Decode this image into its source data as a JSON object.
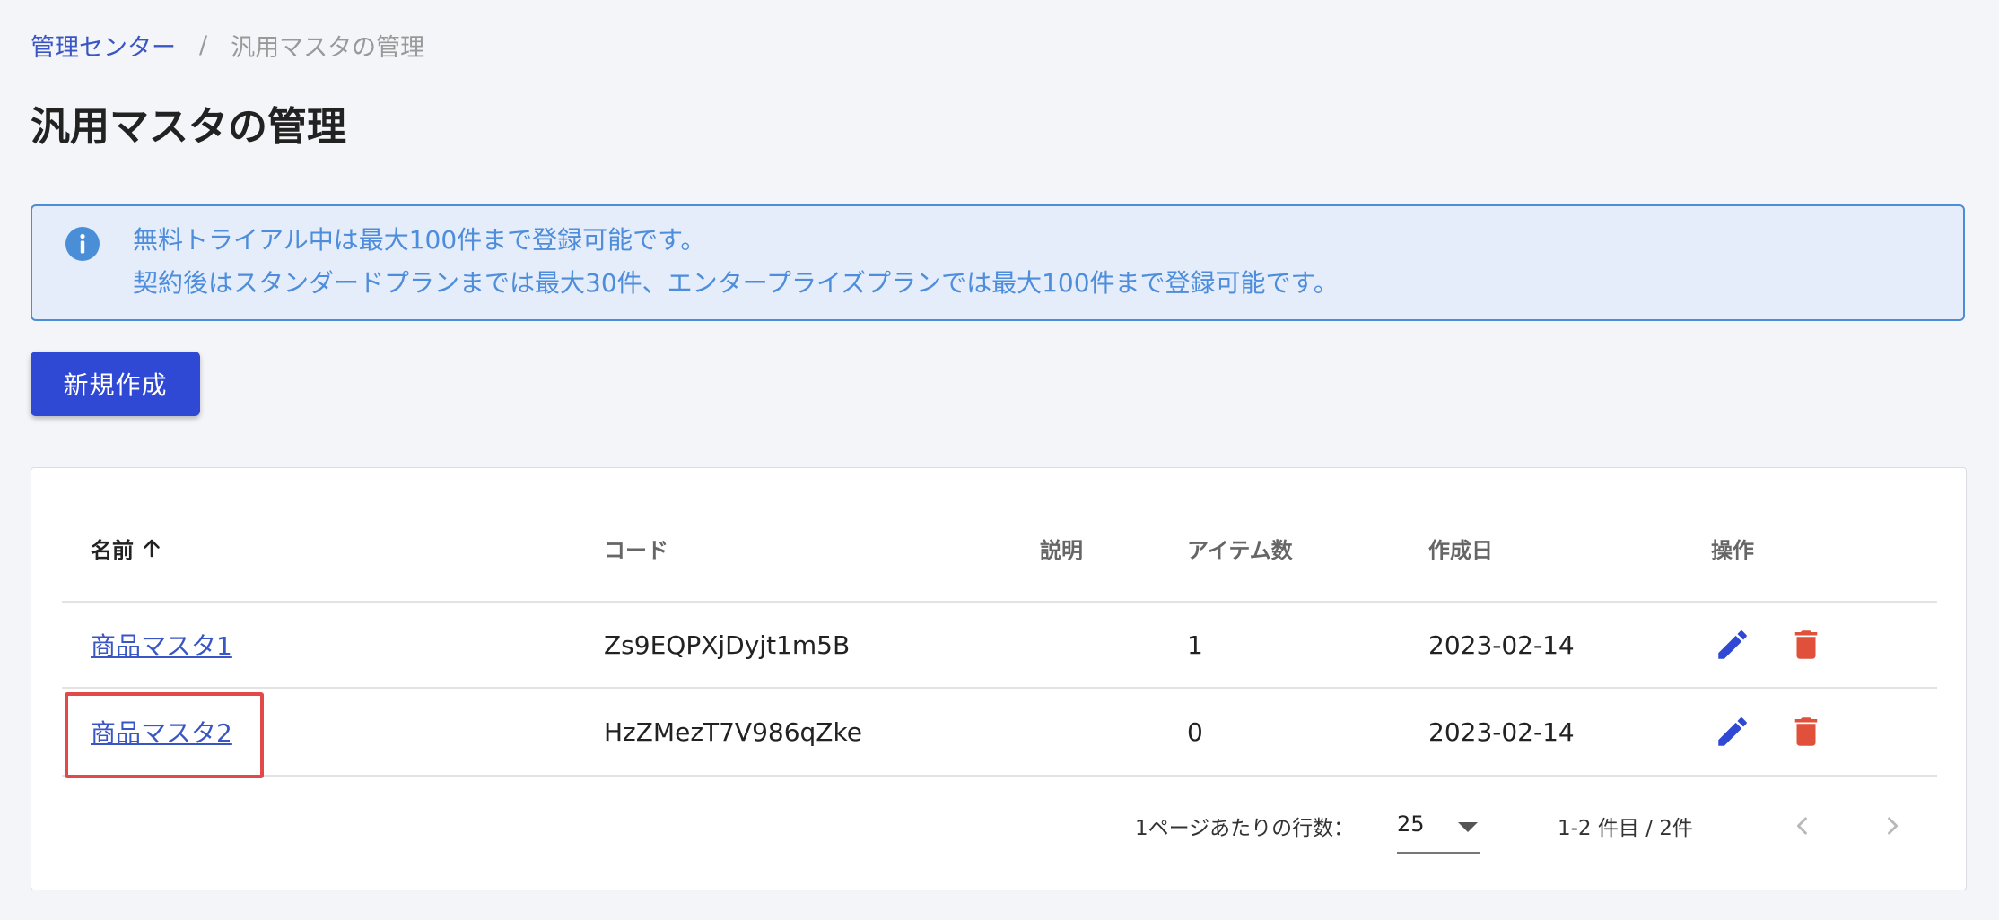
{
  "breadcrumb": {
    "parent": "管理センター",
    "separator": "/",
    "current": "汎用マスタの管理"
  },
  "page": {
    "title": "汎用マスタの管理"
  },
  "alert": {
    "icon": "info-icon",
    "line1": "無料トライアル中は最大100件まで登録可能です。",
    "line2": "契約後はスタンダードプランまでは最大30件、エンタープライズプランでは最大100件まで登録可能です。"
  },
  "actions": {
    "create_label": "新規作成"
  },
  "table": {
    "columns": {
      "name": "名前",
      "code": "コード",
      "description": "説明",
      "items": "アイテム数",
      "created": "作成日",
      "operations": "操作"
    },
    "sort": {
      "column": "name",
      "direction": "ascending"
    },
    "rows": [
      {
        "name": "商品マスタ1",
        "code": "Zs9EQPXjDyjt1m5B",
        "description": "",
        "items": "1",
        "created": "2023-02-14"
      },
      {
        "name": "商品マスタ2",
        "code": "HzZMezT7V986qZke",
        "description": "",
        "items": "0",
        "created": "2023-02-14"
      }
    ]
  },
  "pagination": {
    "rows_per_page_label": "1ページあたりの行数：",
    "rows_per_page_value": "25",
    "range_text": "1-2 件目 / 2件"
  },
  "colors": {
    "primary": "#3049d4",
    "link": "#3a56c4",
    "info_text": "#4e8ddb",
    "info_background": "#e4edf9",
    "info_border": "#4b8ed8",
    "edit_icon": "#3049d4",
    "delete_icon": "#e0503b",
    "highlight": "#e24a4a"
  }
}
